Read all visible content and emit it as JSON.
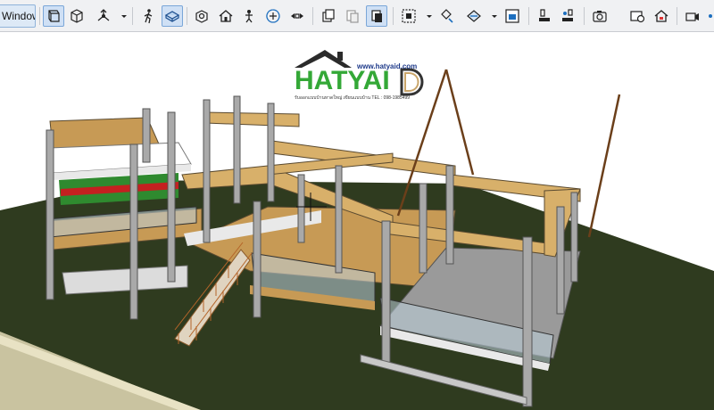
{
  "toolbar": {
    "window_label": "Window",
    "icons": [
      "wireframe-view-icon",
      "solid-view-icon",
      "render-mode-icon",
      "walk-through-icon",
      "3d-navigation-icon",
      "object-snap-icon",
      "home-view-icon",
      "person-view-icon",
      "sun-study-icon",
      "orbit-icon",
      "copy-view-icon",
      "paste-view-icon",
      "filter-icon",
      "marquee-icon",
      "show-hide-icon",
      "section-box-icon",
      "save-view-icon",
      "paint-icon",
      "material-picker-icon",
      "camera-icon",
      "render-image-icon",
      "house-icon",
      "video-camera-icon",
      "more-icon"
    ]
  },
  "logo": {
    "url": "www.hatyaid.com",
    "name": "HATYAI",
    "tagline": "รับออกแบบบ้านหาดใหญ่ เขียนแบบบ้าน TEL : 098-1985499",
    "colors": {
      "text": "#34a837",
      "roof": "#2b2b2b",
      "url": "#1e3a8a"
    }
  },
  "scene": {
    "description_colors": {
      "ground": "#2f3b1f",
      "beam": "#d8b06a",
      "slab": "#c79a55",
      "column": "#a9a9a9",
      "floor_tile": "#9a9a9a"
    }
  }
}
